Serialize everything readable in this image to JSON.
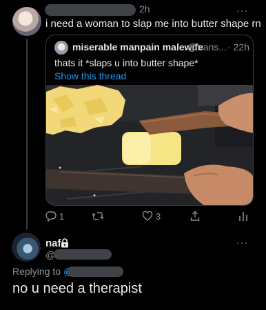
{
  "tweet": {
    "time": "2h",
    "more_label": "···",
    "text": "i need a woman to slap me into butter shape rn"
  },
  "quote": {
    "name": "miserable manpain malewife",
    "handle": "@trans...",
    "separator_time": "· 22h",
    "text": "thats it *slaps u into butter shape*",
    "show_thread": "Show this thread"
  },
  "actions": {
    "reply_count": "1",
    "retweet_count": "",
    "like_count": "3",
    "icons": [
      "reply-icon",
      "retweet-icon",
      "like-icon",
      "share-icon",
      "analytics-icon"
    ]
  },
  "reply": {
    "name": "naf",
    "at": "@",
    "more_label": "···",
    "replying_prefix": "Replying to",
    "replying_at": "@",
    "text": "no u need a therapist"
  },
  "colors": {
    "background": "#000000",
    "text": "#e7e9ea",
    "muted": "#8b9096",
    "link": "#1d9bf0",
    "border": "#3a3d40",
    "redaction": "#3f4246"
  }
}
